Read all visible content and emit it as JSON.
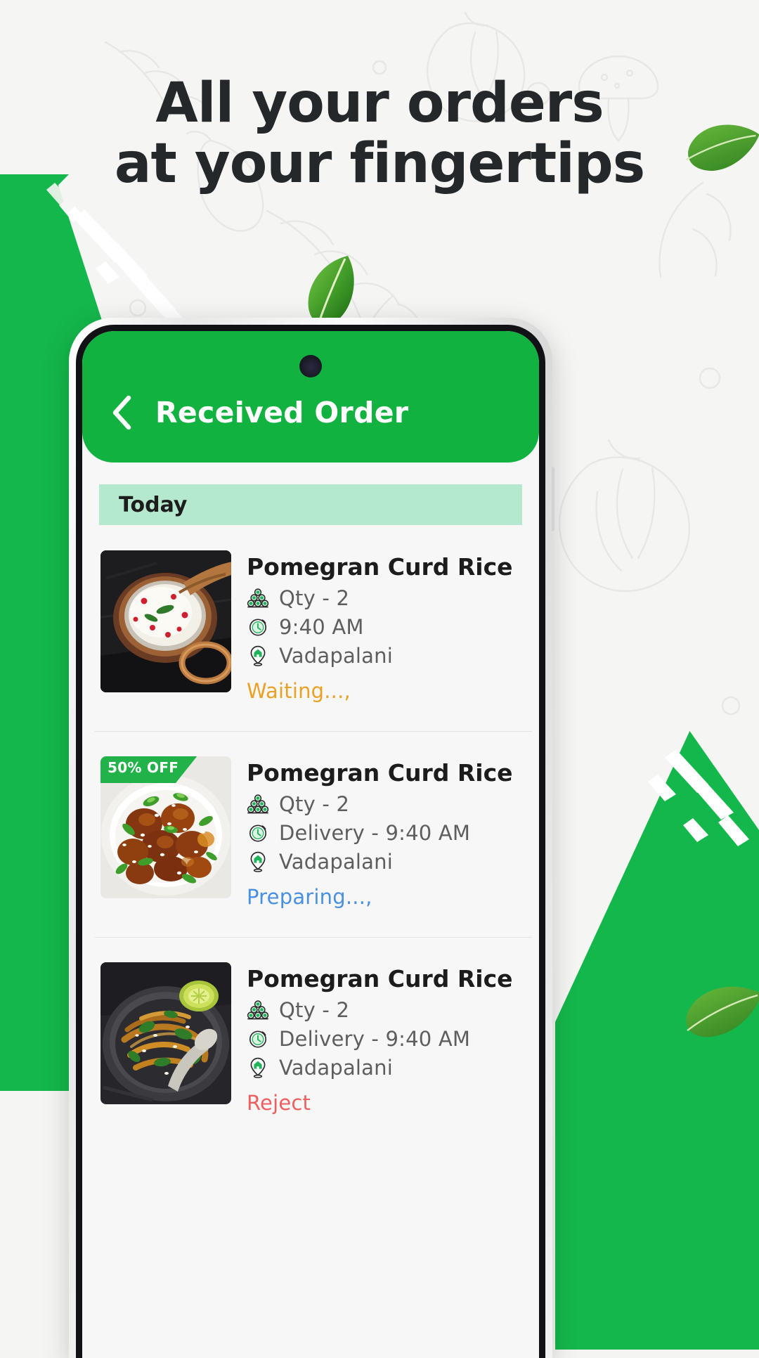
{
  "headline": {
    "line1": "All your orders",
    "line2": "at your fingertips"
  },
  "colors": {
    "brand_green": "#11b23f",
    "brush_green": "#14b74b",
    "banner_green": "#b5e9cf",
    "page_bg": "#f5f5f3",
    "status_waiting": "#e9a226",
    "status_preparing": "#4a90e2",
    "status_reject": "#ef5f5f",
    "badge_green": "#21b34a",
    "title_dark": "#25282b"
  },
  "phone": {
    "header": {
      "back_icon": "chevron-left-icon",
      "title": "Received Order"
    },
    "section_banner": {
      "label": "Today"
    },
    "orders": [
      {
        "title": "Pomegran Curd Rice",
        "qty_icon": "stacked-balls-qty-icon",
        "qty_text": "Qty - 2",
        "time_icon": "clock-icon",
        "time_text": "9:40 AM",
        "location_icon": "location-pin-home-icon",
        "location_text": "Vadapalani",
        "status_text": "Waiting...,",
        "status_color": "#e9a226",
        "badge": null,
        "image_alt": "curd-rice-in-copper-bowl"
      },
      {
        "title": "Pomegran Curd Rice",
        "qty_icon": "stacked-balls-qty-icon",
        "qty_text": "Qty - 2",
        "time_icon": "clock-icon",
        "time_text": "Delivery - 9:40 AM",
        "location_icon": "location-pin-home-icon",
        "location_text": "Vadapalani",
        "status_text": "Preparing...,",
        "status_color": "#4a90e2",
        "badge": "50% OFF",
        "image_alt": "glazed-chicken-with-spring-onion"
      },
      {
        "title": "Pomegran Curd Rice",
        "qty_icon": "stacked-balls-qty-icon",
        "qty_text": "Qty - 2",
        "time_icon": "clock-icon",
        "time_text": "Delivery - 9:40 AM",
        "location_icon": "location-pin-home-icon",
        "location_text": "Vadapalani",
        "status_text": "Reject",
        "status_color": "#ef5f5f",
        "badge": null,
        "image_alt": "noodles-with-lime-in-pan"
      }
    ]
  }
}
